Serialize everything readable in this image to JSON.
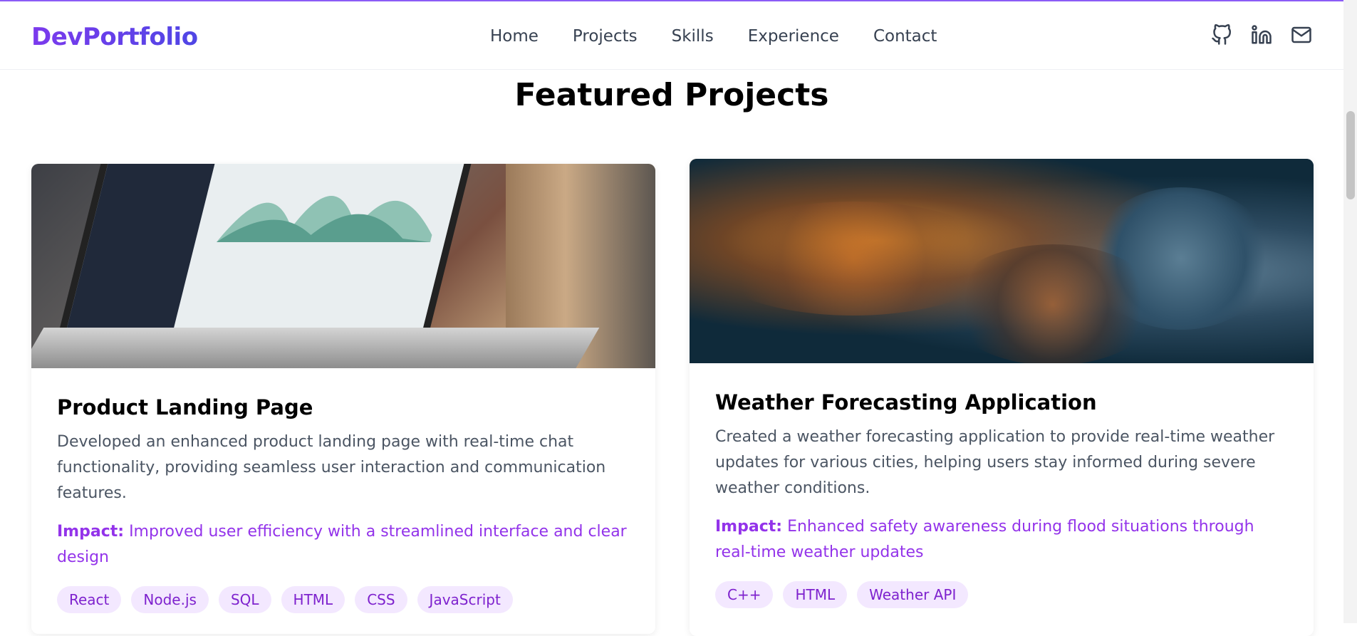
{
  "brand": {
    "logo": "DevPortfolio"
  },
  "nav": {
    "links": [
      "Home",
      "Projects",
      "Skills",
      "Experience",
      "Contact"
    ]
  },
  "socials": [
    "github-icon",
    "linkedin-icon",
    "mail-icon"
  ],
  "section": {
    "title": "Featured Projects"
  },
  "projects": [
    {
      "title": "Product Landing Page",
      "description": "Developed an enhanced product landing page with real-time chat functionality, providing seamless user interaction and communication features.",
      "impact_label": "Impact:",
      "impact": "Improved user efficiency with a streamlined interface and clear design",
      "tags": [
        "React",
        "Node.js",
        "SQL",
        "HTML",
        "CSS",
        "JavaScript"
      ]
    },
    {
      "title": "Weather Forecasting Application",
      "description": "Created a weather forecasting application to provide real-time weather updates for various cities, helping users stay informed during severe weather conditions.",
      "impact_label": "Impact:",
      "impact": "Enhanced safety awareness during flood situations through real-time weather updates",
      "tags": [
        "C++",
        "HTML",
        "Weather API"
      ]
    }
  ],
  "colors": {
    "accent": "#9333ea",
    "tag_bg": "#f3e8ff",
    "tag_text": "#7e22ce"
  }
}
